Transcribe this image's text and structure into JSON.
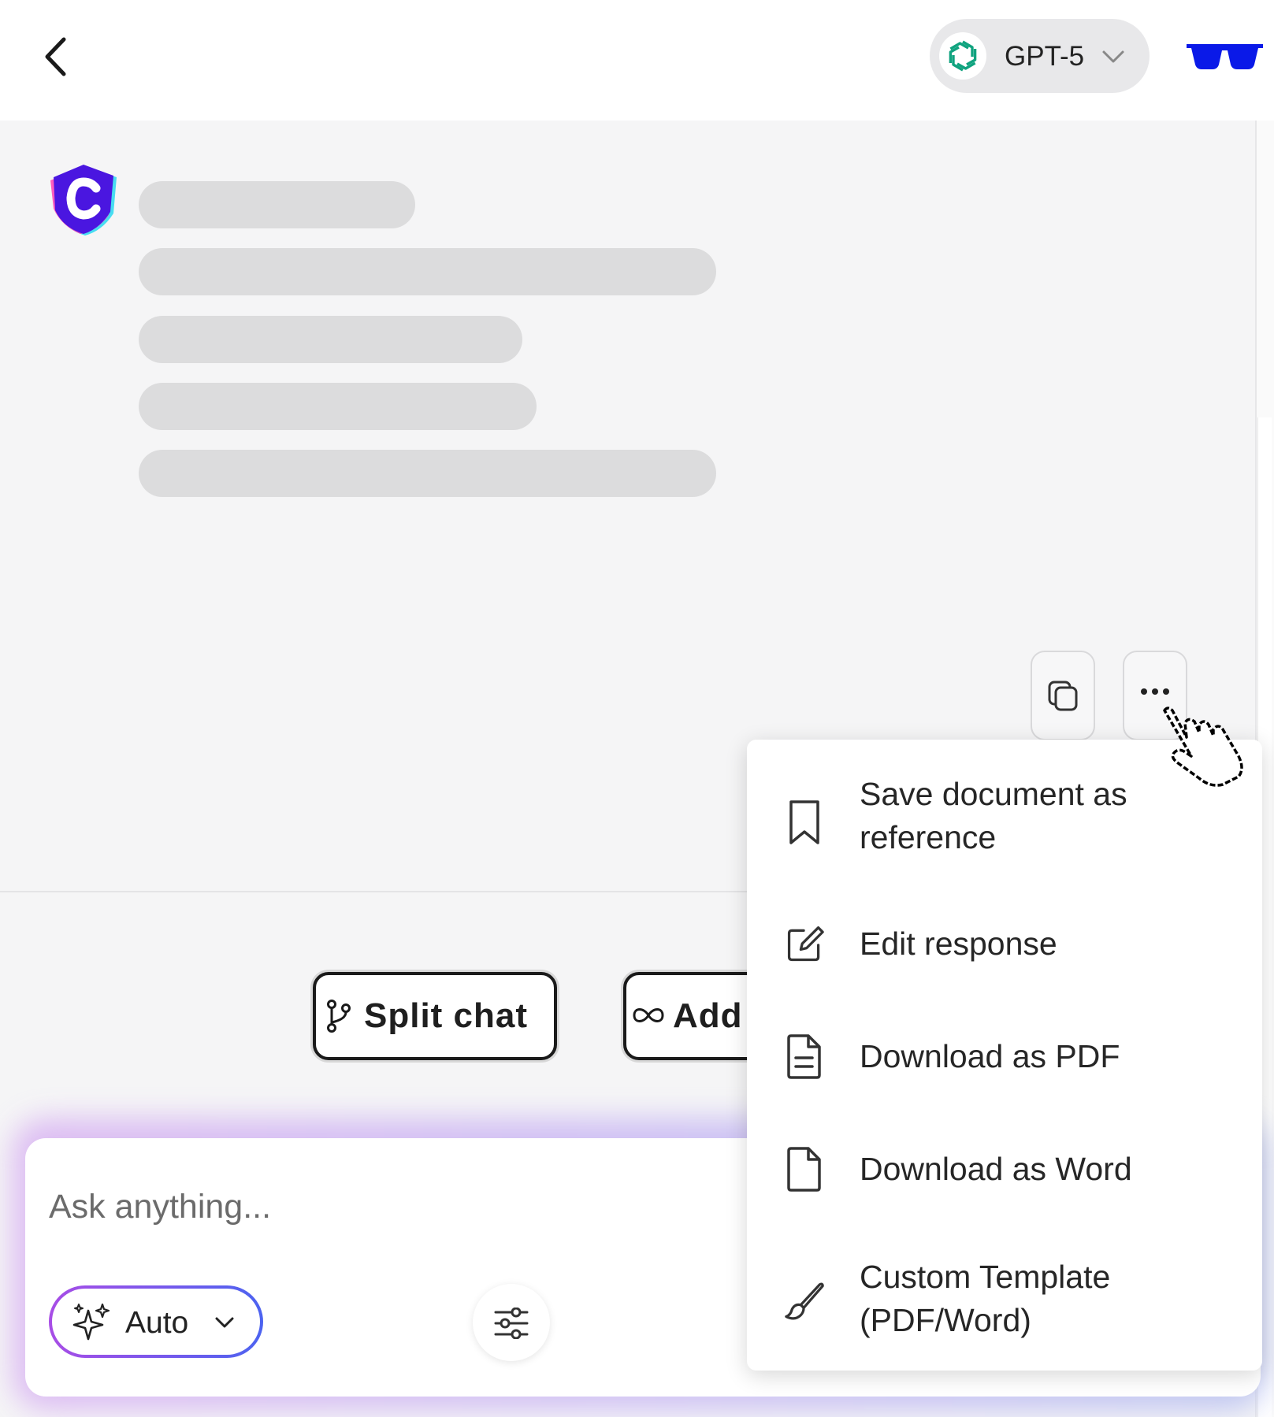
{
  "header": {
    "model": {
      "label": "GPT-5",
      "logo": "openai-logo-icon",
      "brand_color": "#10a37f"
    },
    "accent_glasses_color": "#0a19e8"
  },
  "chat": {
    "assistant_avatar": "c-logo-icon",
    "message_state": "loading-skeleton"
  },
  "message_actions": {
    "copy": "copy-icon",
    "more": "more-horizontal-icon"
  },
  "menu": {
    "items": [
      {
        "label": "Save document as reference",
        "icon": "bookmark-icon"
      },
      {
        "label": "Edit response",
        "icon": "edit-icon"
      },
      {
        "label": "Download as PDF",
        "icon": "file-text-icon"
      },
      {
        "label": "Download as Word",
        "icon": "file-icon"
      },
      {
        "label": "Custom Template (PDF/Word)",
        "icon": "brush-icon"
      }
    ]
  },
  "actions": {
    "split_chat": "Split chat",
    "add": "Add"
  },
  "composer": {
    "placeholder": "Ask anything...",
    "mode_label": "Auto"
  }
}
